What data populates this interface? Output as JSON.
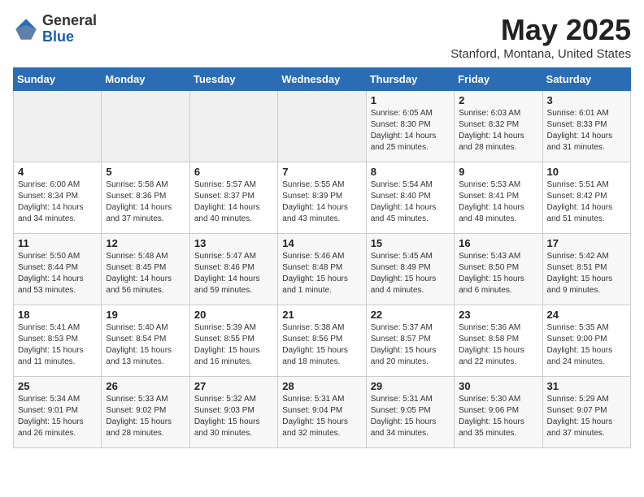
{
  "logo": {
    "general": "General",
    "blue": "Blue"
  },
  "title": "May 2025",
  "location": "Stanford, Montana, United States",
  "days_header": [
    "Sunday",
    "Monday",
    "Tuesday",
    "Wednesday",
    "Thursday",
    "Friday",
    "Saturday"
  ],
  "weeks": [
    [
      {
        "day": "",
        "info": ""
      },
      {
        "day": "",
        "info": ""
      },
      {
        "day": "",
        "info": ""
      },
      {
        "day": "",
        "info": ""
      },
      {
        "day": "1",
        "info": "Sunrise: 6:05 AM\nSunset: 8:30 PM\nDaylight: 14 hours\nand 25 minutes."
      },
      {
        "day": "2",
        "info": "Sunrise: 6:03 AM\nSunset: 8:32 PM\nDaylight: 14 hours\nand 28 minutes."
      },
      {
        "day": "3",
        "info": "Sunrise: 6:01 AM\nSunset: 8:33 PM\nDaylight: 14 hours\nand 31 minutes."
      }
    ],
    [
      {
        "day": "4",
        "info": "Sunrise: 6:00 AM\nSunset: 8:34 PM\nDaylight: 14 hours\nand 34 minutes."
      },
      {
        "day": "5",
        "info": "Sunrise: 5:58 AM\nSunset: 8:36 PM\nDaylight: 14 hours\nand 37 minutes."
      },
      {
        "day": "6",
        "info": "Sunrise: 5:57 AM\nSunset: 8:37 PM\nDaylight: 14 hours\nand 40 minutes."
      },
      {
        "day": "7",
        "info": "Sunrise: 5:55 AM\nSunset: 8:39 PM\nDaylight: 14 hours\nand 43 minutes."
      },
      {
        "day": "8",
        "info": "Sunrise: 5:54 AM\nSunset: 8:40 PM\nDaylight: 14 hours\nand 45 minutes."
      },
      {
        "day": "9",
        "info": "Sunrise: 5:53 AM\nSunset: 8:41 PM\nDaylight: 14 hours\nand 48 minutes."
      },
      {
        "day": "10",
        "info": "Sunrise: 5:51 AM\nSunset: 8:42 PM\nDaylight: 14 hours\nand 51 minutes."
      }
    ],
    [
      {
        "day": "11",
        "info": "Sunrise: 5:50 AM\nSunset: 8:44 PM\nDaylight: 14 hours\nand 53 minutes."
      },
      {
        "day": "12",
        "info": "Sunrise: 5:48 AM\nSunset: 8:45 PM\nDaylight: 14 hours\nand 56 minutes."
      },
      {
        "day": "13",
        "info": "Sunrise: 5:47 AM\nSunset: 8:46 PM\nDaylight: 14 hours\nand 59 minutes."
      },
      {
        "day": "14",
        "info": "Sunrise: 5:46 AM\nSunset: 8:48 PM\nDaylight: 15 hours\nand 1 minute."
      },
      {
        "day": "15",
        "info": "Sunrise: 5:45 AM\nSunset: 8:49 PM\nDaylight: 15 hours\nand 4 minutes."
      },
      {
        "day": "16",
        "info": "Sunrise: 5:43 AM\nSunset: 8:50 PM\nDaylight: 15 hours\nand 6 minutes."
      },
      {
        "day": "17",
        "info": "Sunrise: 5:42 AM\nSunset: 8:51 PM\nDaylight: 15 hours\nand 9 minutes."
      }
    ],
    [
      {
        "day": "18",
        "info": "Sunrise: 5:41 AM\nSunset: 8:53 PM\nDaylight: 15 hours\nand 11 minutes."
      },
      {
        "day": "19",
        "info": "Sunrise: 5:40 AM\nSunset: 8:54 PM\nDaylight: 15 hours\nand 13 minutes."
      },
      {
        "day": "20",
        "info": "Sunrise: 5:39 AM\nSunset: 8:55 PM\nDaylight: 15 hours\nand 16 minutes."
      },
      {
        "day": "21",
        "info": "Sunrise: 5:38 AM\nSunset: 8:56 PM\nDaylight: 15 hours\nand 18 minutes."
      },
      {
        "day": "22",
        "info": "Sunrise: 5:37 AM\nSunset: 8:57 PM\nDaylight: 15 hours\nand 20 minutes."
      },
      {
        "day": "23",
        "info": "Sunrise: 5:36 AM\nSunset: 8:58 PM\nDaylight: 15 hours\nand 22 minutes."
      },
      {
        "day": "24",
        "info": "Sunrise: 5:35 AM\nSunset: 9:00 PM\nDaylight: 15 hours\nand 24 minutes."
      }
    ],
    [
      {
        "day": "25",
        "info": "Sunrise: 5:34 AM\nSunset: 9:01 PM\nDaylight: 15 hours\nand 26 minutes."
      },
      {
        "day": "26",
        "info": "Sunrise: 5:33 AM\nSunset: 9:02 PM\nDaylight: 15 hours\nand 28 minutes."
      },
      {
        "day": "27",
        "info": "Sunrise: 5:32 AM\nSunset: 9:03 PM\nDaylight: 15 hours\nand 30 minutes."
      },
      {
        "day": "28",
        "info": "Sunrise: 5:31 AM\nSunset: 9:04 PM\nDaylight: 15 hours\nand 32 minutes."
      },
      {
        "day": "29",
        "info": "Sunrise: 5:31 AM\nSunset: 9:05 PM\nDaylight: 15 hours\nand 34 minutes."
      },
      {
        "day": "30",
        "info": "Sunrise: 5:30 AM\nSunset: 9:06 PM\nDaylight: 15 hours\nand 35 minutes."
      },
      {
        "day": "31",
        "info": "Sunrise: 5:29 AM\nSunset: 9:07 PM\nDaylight: 15 hours\nand 37 minutes."
      }
    ]
  ]
}
